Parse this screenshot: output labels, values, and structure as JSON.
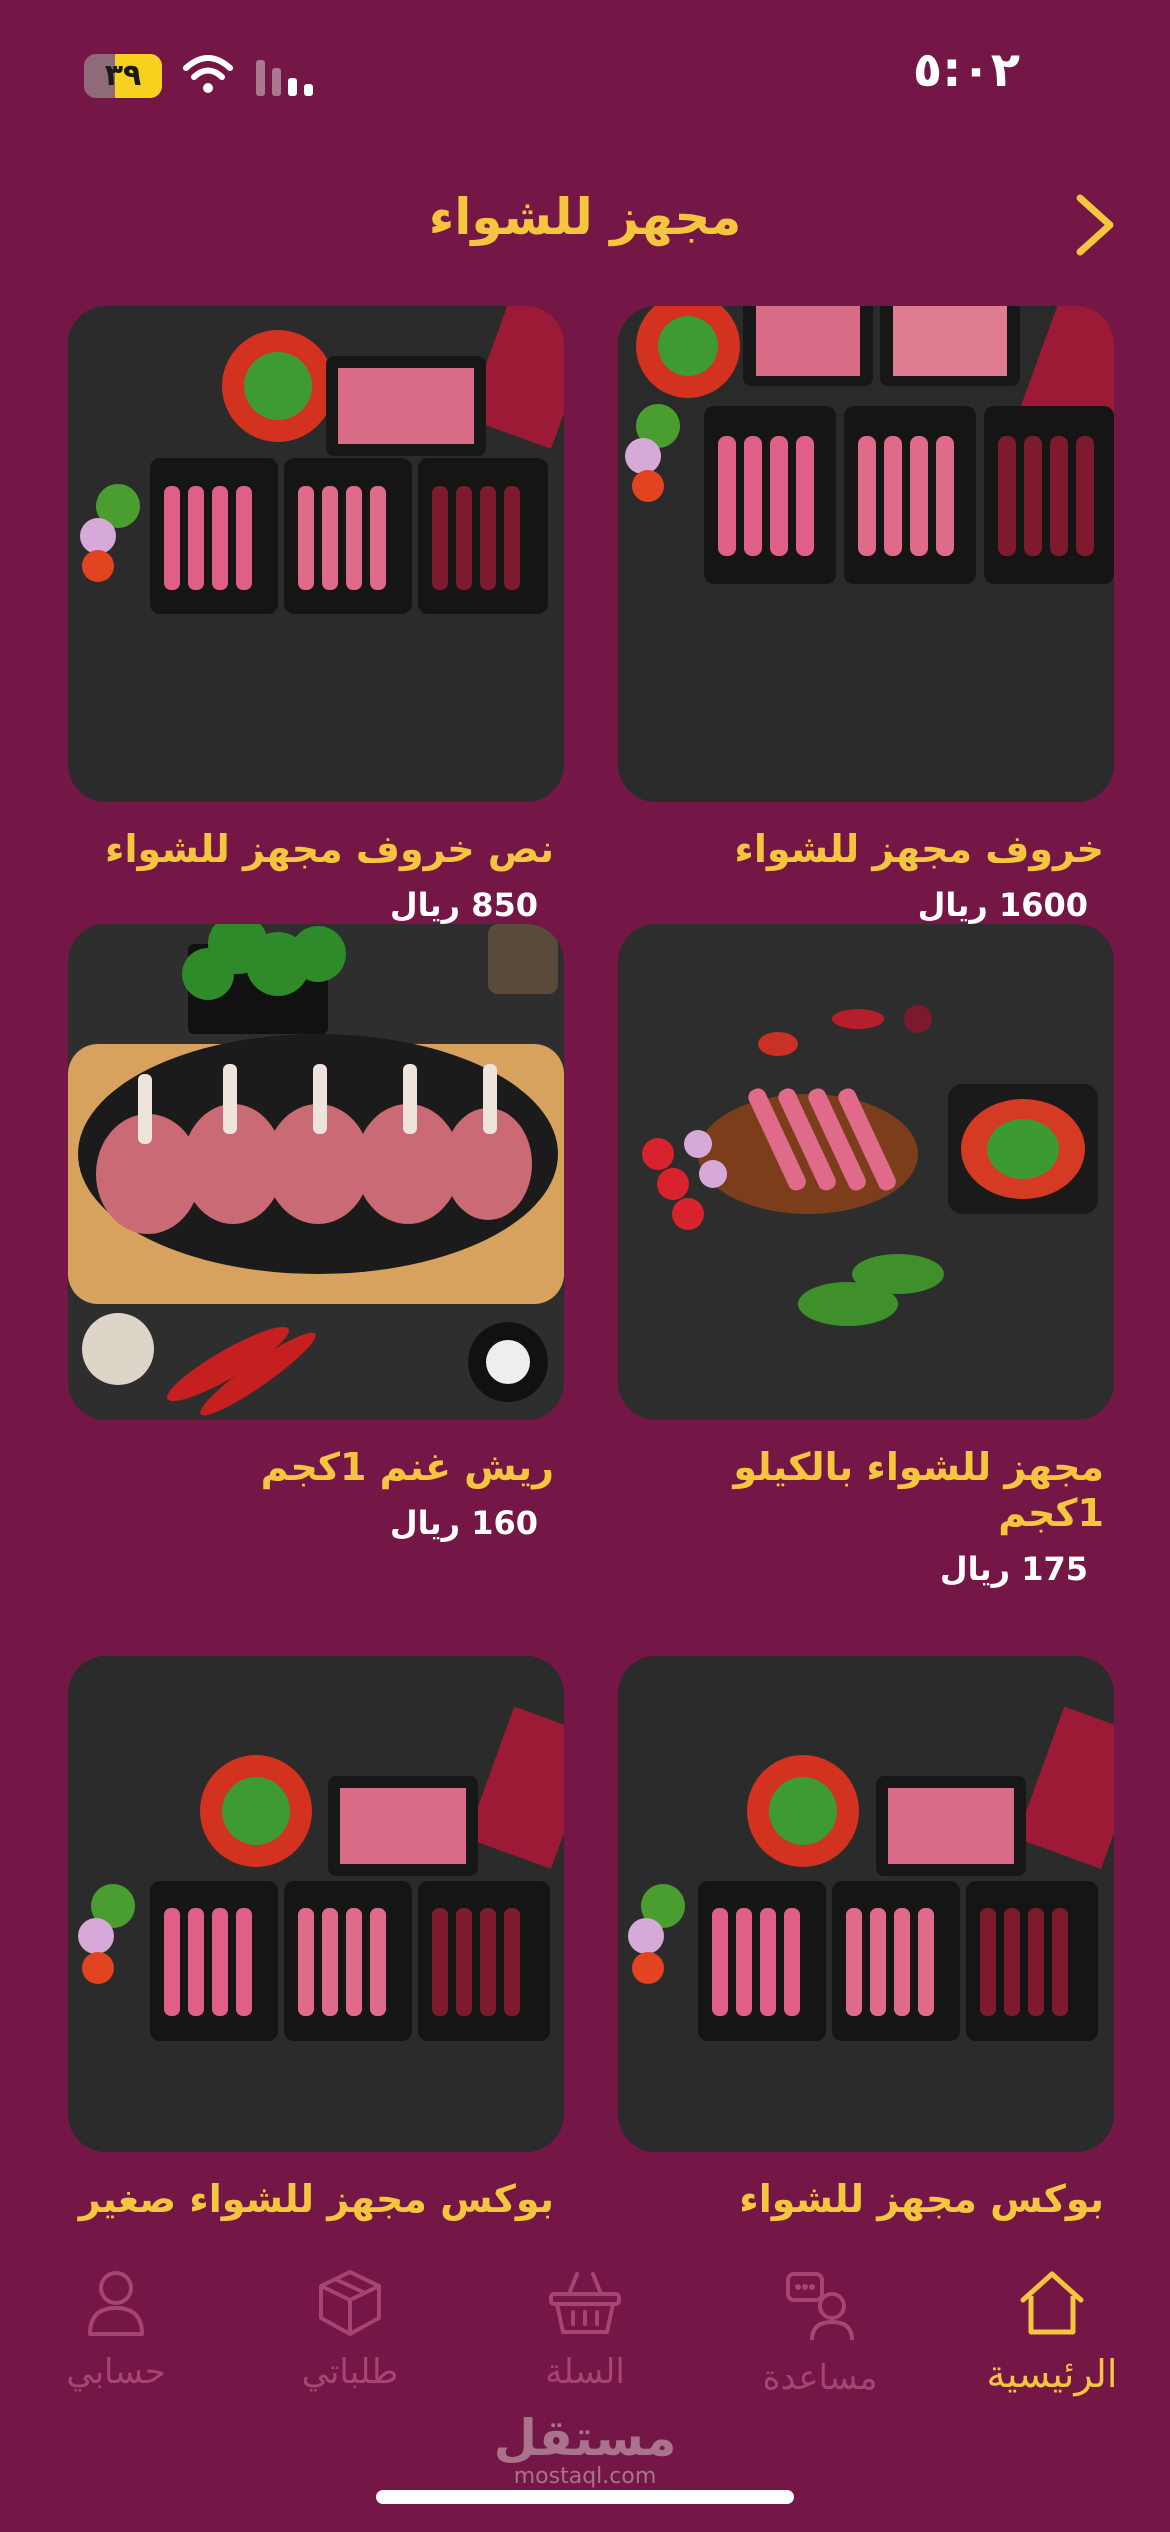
{
  "status_bar": {
    "time": "٥:٠٢",
    "battery_level": "٣٩"
  },
  "header": {
    "title": "مجهز للشواء"
  },
  "products": [
    {
      "name": "خروف مجهز للشواء",
      "price": "1600 ريال"
    },
    {
      "name": "نص خروف مجهز للشواء",
      "price": "850 ريال"
    },
    {
      "name": "مجهز للشواء بالكيلو 1كجم",
      "price": "175 ريال"
    },
    {
      "name": "ريش غنم   1كجم",
      "price": "160 ريال"
    },
    {
      "name": "بوكس مجهز للشواء",
      "price": ""
    },
    {
      "name": "بوكس مجهز للشواء صغير",
      "price": ""
    }
  ],
  "nav": {
    "home": "الرئيسية",
    "help": "مساعدة",
    "cart": "السلة",
    "orders": "طلباتي",
    "account": "حسابي"
  },
  "watermark": {
    "brand": "مستقل",
    "url": "mostaql.com"
  },
  "colors": {
    "background": "#741747",
    "accent": "#f4c53f",
    "nav_inactive": "#a44671"
  }
}
